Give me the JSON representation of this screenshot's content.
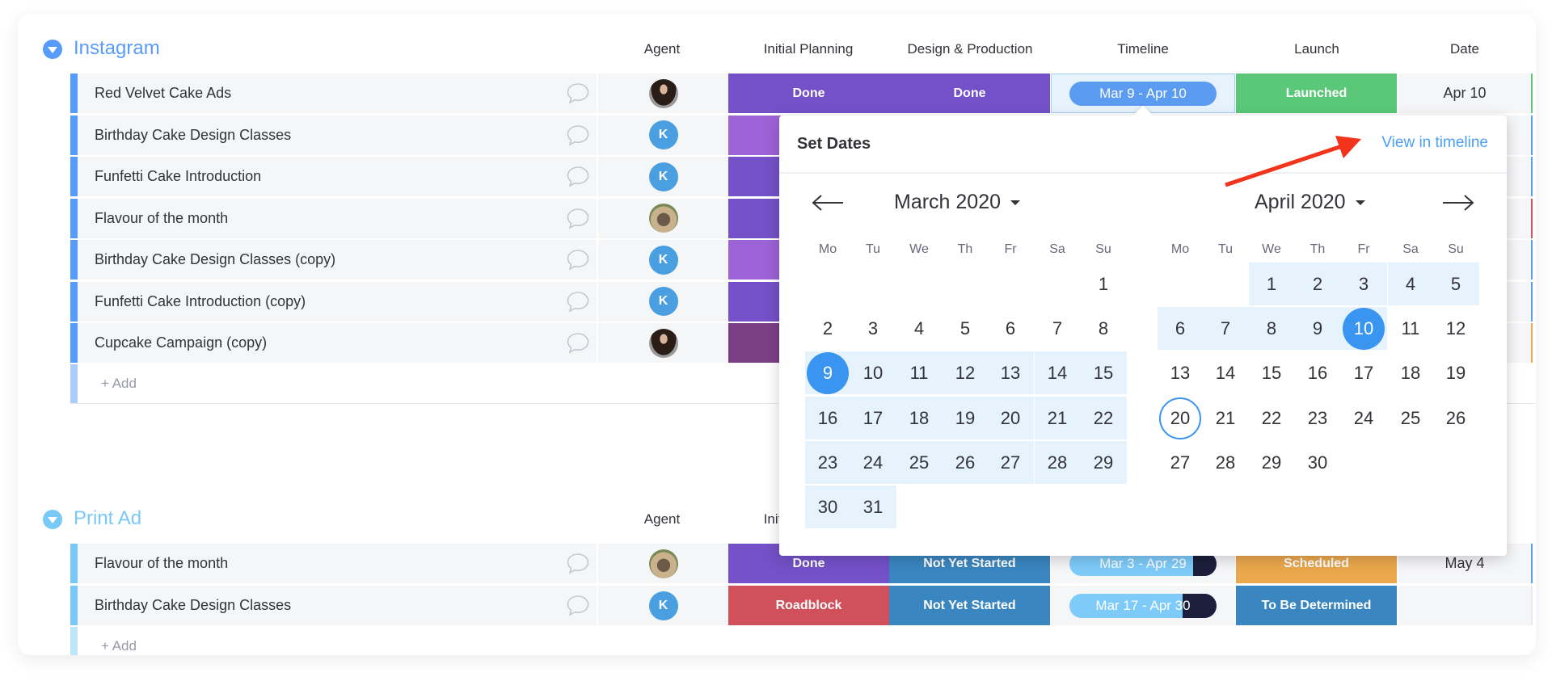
{
  "colors": {
    "accent": "#579bfc",
    "instagram_group": "#579bfc",
    "print_group": "#79c9f8",
    "done": "#7451c8",
    "working": "#9c63d6",
    "stuck_dark": "#7b3f86",
    "launched": "#5ac878",
    "roadblock": "#d0505c",
    "not_yet_started": "#3a86c0",
    "scheduled": "#eba84d",
    "tbd": "#3a86c0",
    "timeline_pill": "#5b9cf2",
    "timeline_pill_light": "#7ecbfa",
    "avatar_k": "#4a9fe0",
    "arrow": "#f2341c"
  },
  "columns": {
    "agent": "Agent",
    "initial_planning": "Initial Planning",
    "design_production": "Design & Production",
    "timeline": "Timeline",
    "launch": "Launch",
    "date": "Date"
  },
  "groups": [
    {
      "title": "Instagram",
      "add_label": "+ Add",
      "rows": [
        {
          "name": "Red Velvet Cake Ads",
          "agent": {
            "type": "photo-woman",
            "initial": ""
          },
          "initial_planning": {
            "label": "Done",
            "color": "#7451c8"
          },
          "design": {
            "label": "Done",
            "color": "#7451c8"
          },
          "timeline": {
            "label": "Mar 9 - Apr 10",
            "progress": 0,
            "active": true
          },
          "launch": {
            "label": "Launched",
            "color": "#5ac878"
          },
          "date": "Apr 10",
          "edge": "#5ac878"
        },
        {
          "name": "Birthday Cake Design Classes",
          "agent": {
            "type": "initial",
            "initial": "K"
          },
          "initial_planning": {
            "label": "",
            "color": "#9c63d6"
          },
          "design": null,
          "timeline": null,
          "launch": null,
          "date": "",
          "edge": "#579bfc"
        },
        {
          "name": "Funfetti Cake Introduction",
          "agent": {
            "type": "initial",
            "initial": "K"
          },
          "initial_planning": {
            "label": "",
            "color": "#7451c8"
          },
          "design": null,
          "timeline": null,
          "launch": null,
          "date": "",
          "edge": "#579bfc"
        },
        {
          "name": "Flavour of the month",
          "agent": {
            "type": "photo-pug",
            "initial": ""
          },
          "initial_planning": {
            "label": "",
            "color": "#7451c8"
          },
          "design": null,
          "timeline": null,
          "launch": null,
          "date": "",
          "edge": "#d0505c"
        },
        {
          "name": "Birthday Cake Design Classes (copy)",
          "agent": {
            "type": "initial",
            "initial": "K"
          },
          "initial_planning": {
            "label": "",
            "color": "#9c63d6"
          },
          "design": null,
          "timeline": null,
          "launch": null,
          "date": "",
          "edge": "#579bfc"
        },
        {
          "name": "Funfetti Cake Introduction (copy)",
          "agent": {
            "type": "initial",
            "initial": "K"
          },
          "initial_planning": {
            "label": "",
            "color": "#7451c8"
          },
          "design": null,
          "timeline": null,
          "launch": null,
          "date": "",
          "edge": "#579bfc"
        },
        {
          "name": "Cupcake Campaign (copy)",
          "agent": {
            "type": "photo-woman",
            "initial": ""
          },
          "initial_planning": {
            "label": "",
            "color": "#7b3f86"
          },
          "design": null,
          "timeline": null,
          "launch": null,
          "date": "",
          "edge": "#eba84d"
        }
      ]
    },
    {
      "title": "Print Ad",
      "add_label": "+ Add",
      "rows": [
        {
          "name": "Flavour of the month",
          "agent": {
            "type": "photo-pug",
            "initial": ""
          },
          "initial_planning": {
            "label": "Done",
            "color": "#7451c8"
          },
          "design": {
            "label": "Not Yet Started",
            "color": "#3a86c0"
          },
          "timeline": {
            "label": "Mar 3 - Apr 29",
            "progress": 0.84,
            "active": false
          },
          "launch": {
            "label": "Scheduled",
            "color": "#eba84d"
          },
          "date": "May 4",
          "edge": "#579bfc"
        },
        {
          "name": "Birthday Cake Design Classes",
          "agent": {
            "type": "initial",
            "initial": "K"
          },
          "initial_planning": {
            "label": "Roadblock",
            "color": "#d0505c"
          },
          "design": {
            "label": "Not Yet Started",
            "color": "#3a86c0"
          },
          "timeline": {
            "label": "Mar 17 - Apr 30",
            "progress": 0.77,
            "active": false
          },
          "launch": {
            "label": "To Be Determined",
            "color": "#3a86c0"
          },
          "date": "",
          "edge": "#e6e9ef"
        }
      ]
    }
  ],
  "date_picker": {
    "title": "Set Dates",
    "view_link": "View in timeline",
    "weekdays": [
      "Mo",
      "Tu",
      "We",
      "Th",
      "Fr",
      "Sa",
      "Su"
    ],
    "selection": {
      "start": "Mar 9",
      "end": "Apr 10",
      "today": "Apr 20"
    },
    "months": [
      {
        "label": "March 2020",
        "key": "Mar",
        "weeks": [
          [
            null,
            null,
            null,
            null,
            null,
            null,
            1
          ],
          [
            2,
            3,
            4,
            5,
            6,
            7,
            8
          ],
          [
            9,
            10,
            11,
            12,
            13,
            14,
            15
          ],
          [
            16,
            17,
            18,
            19,
            20,
            21,
            22
          ],
          [
            23,
            24,
            25,
            26,
            27,
            28,
            29
          ],
          [
            30,
            31,
            null,
            null,
            null,
            null,
            null
          ]
        ]
      },
      {
        "label": "April 2020",
        "key": "Apr",
        "weeks": [
          [
            null,
            null,
            1,
            2,
            3,
            4,
            5
          ],
          [
            6,
            7,
            8,
            9,
            10,
            11,
            12
          ],
          [
            13,
            14,
            15,
            16,
            17,
            18,
            19
          ],
          [
            20,
            21,
            22,
            23,
            24,
            25,
            26
          ],
          [
            27,
            28,
            29,
            30,
            null,
            null,
            null
          ]
        ]
      }
    ],
    "icons": {
      "prev": "arrow-left-icon",
      "next": "arrow-right-icon",
      "caret": "caret-down-icon"
    }
  }
}
